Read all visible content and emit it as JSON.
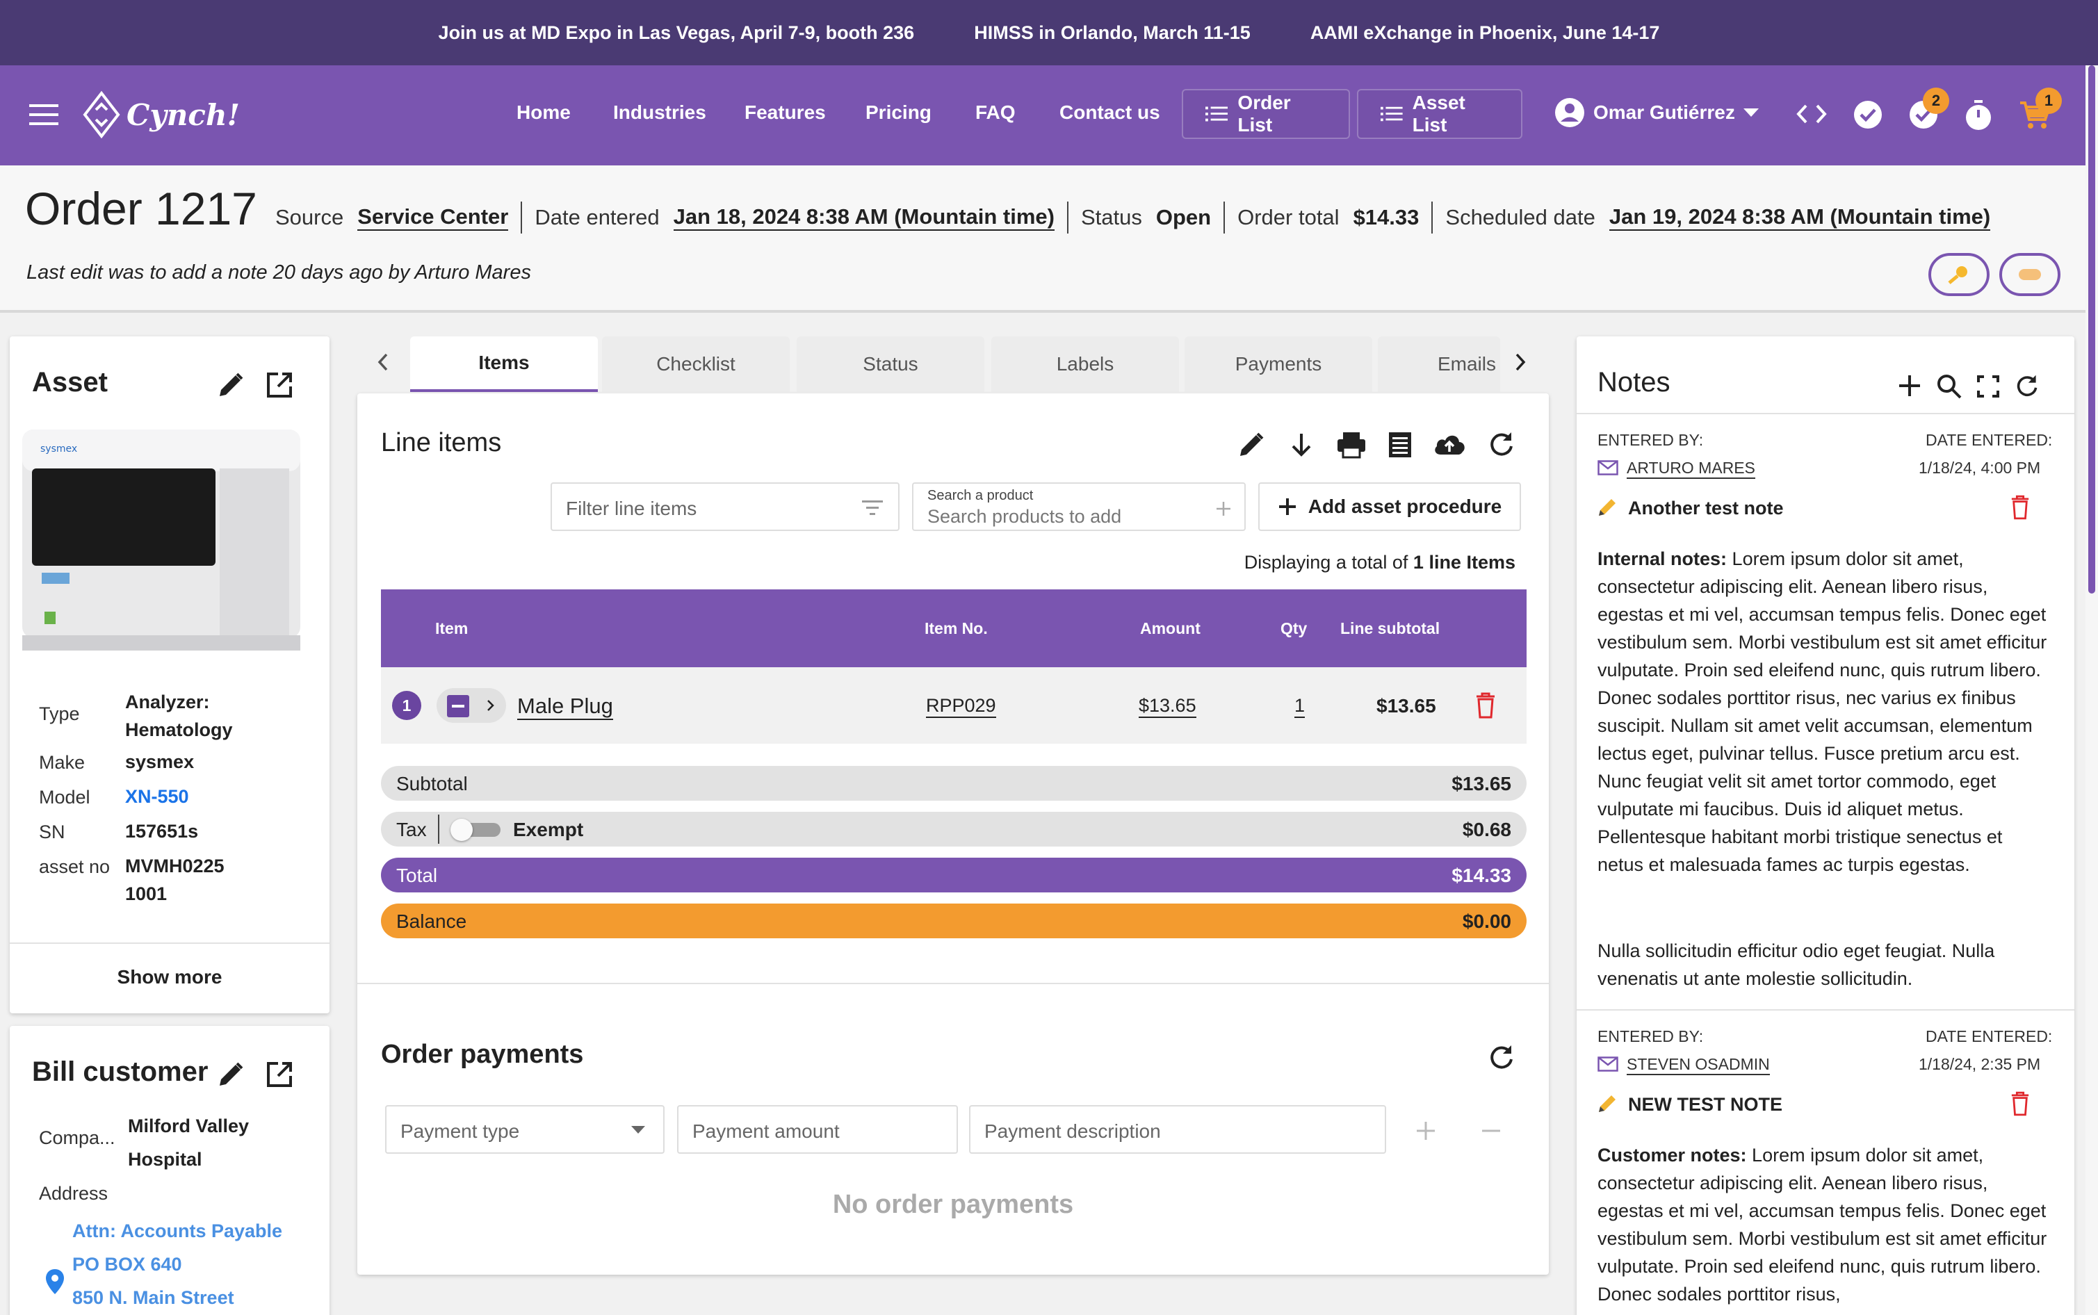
{
  "banner": {
    "items": [
      "Join us at MD Expo in Las Vegas, April 7-9, booth 236",
      "HIMSS in Orlando, March 11-15",
      "AAMI eXchange in Phoenix, June 14-17"
    ]
  },
  "nav": {
    "logo_text": "Cynch!",
    "links": [
      "Home",
      "Industries",
      "Features",
      "Pricing",
      "FAQ",
      "Contact us"
    ],
    "order_list": "Order List",
    "asset_list": "Asset List",
    "user": "Omar Gutiérrez",
    "tasks_badge": "2",
    "cart_badge": "1"
  },
  "order": {
    "title": "Order 1217",
    "source_label": "Source",
    "source": "Service Center",
    "date_entered_label": "Date entered",
    "date_entered": "Jan 18, 2024 8:38 AM (Mountain time)",
    "status_label": "Status",
    "status": "Open",
    "total_label": "Order total",
    "total": "$14.33",
    "scheduled_label": "Scheduled date",
    "scheduled": "Jan 19, 2024 8:38 AM (Mountain time)",
    "last_edit": "Last edit was to add a note 20 days ago by Arturo Mares"
  },
  "asset": {
    "title": "Asset",
    "brand_on_device": "sysmex",
    "type_label": "Type",
    "type": "Analyzer: Hematology",
    "make_label": "Make",
    "make": "sysmex",
    "model_label": "Model",
    "model": "XN-550",
    "sn_label": "SN",
    "sn": "157651s",
    "assetno_label": "asset no",
    "assetno": "MVMH0225 1001",
    "show_more": "Show more"
  },
  "bill": {
    "title": "Bill customer",
    "company_label": "Compa...",
    "company": "Milford Valley Hospital",
    "address_label": "Address",
    "attn": "Attn:  Accounts Payable",
    "line1": "PO BOX 640",
    "line2": "850 N. Main Street"
  },
  "tabs": [
    "Items",
    "Checklist",
    "Status",
    "Labels",
    "Payments",
    "Emails"
  ],
  "line_items": {
    "title": "Line items",
    "filter_placeholder": "Filter line items",
    "search_label": "Search a product",
    "search_placeholder": "Search products to add",
    "add_button": "Add asset procedure",
    "displaying_prefix": "Displaying a total of",
    "displaying_count": "1 line Items",
    "columns": [
      "Item",
      "Item No.",
      "Amount",
      "Qty",
      "Line subtotal"
    ],
    "rows": [
      {
        "index": "1",
        "item": "Male Plug",
        "item_no": "RPP029",
        "amount": "$13.65",
        "qty": "1",
        "subtotal": "$13.65"
      }
    ],
    "subtotal_label": "Subtotal",
    "subtotal": "$13.65",
    "tax_label": "Tax",
    "exempt_label": "Exempt",
    "tax": "$0.68",
    "total_label": "Total",
    "total": "$14.33",
    "balance_label": "Balance",
    "balance": "$0.00"
  },
  "payments": {
    "title": "Order payments",
    "type_placeholder": "Payment type",
    "amount_placeholder": "Payment amount",
    "description_placeholder": "Payment description",
    "empty": "No order payments"
  },
  "notes": {
    "title": "Notes",
    "entered_by_label": "ENTERED BY:",
    "date_entered_label": "DATE ENTERED:",
    "items": [
      {
        "author": "ARTURO MARES",
        "date": "1/18/24, 4:00 PM",
        "title": "Another test note",
        "kind": "Internal notes:",
        "body": "Lorem ipsum dolor sit amet, consectetur adipiscing elit. Aenean libero risus, egestas et mi vel, accumsan tempus felis. Donec eget vestibulum sem. Morbi vestibulum est sit amet efficitur vulputate. Proin sed eleifend nunc, quis rutrum libero. Donec sodales porttitor risus, nec varius ex finibus suscipit. Nullam sit amet velit accumsan, elementum lectus eget, pulvinar tellus. Fusce pretium arcu est. Nunc feugiat velit sit amet tortor commodo, eget vulputate mi faucibus. Duis id aliquet metus. Pellentesque habitant morbi tristique senectus et netus et malesuada fames ac turpis egestas.",
        "body2": "Nulla sollicitudin efficitur odio eget feugiat. Nulla venenatis ut ante molestie sollicitudin."
      },
      {
        "author": "STEVEN OSADMIN",
        "date": "1/18/24, 2:35 PM",
        "title": "NEW TEST NOTE",
        "kind": "Customer notes:",
        "body": "Lorem ipsum dolor sit amet, consectetur adipiscing elit. Aenean libero risus, egestas et mi vel, accumsan tempus felis. Donec eget vestibulum sem. Morbi vestibulum est sit amet efficitur vulputate. Proin sed eleifend nunc, quis rutrum libero. Donec sodales porttitor risus,"
      }
    ]
  },
  "colors": {
    "brand_purple": "#7a55b0",
    "banner": "#4a3a73",
    "balance_orange": "#f39b2f",
    "delete_red": "#e0282d",
    "link_blue": "#1a73e8"
  }
}
